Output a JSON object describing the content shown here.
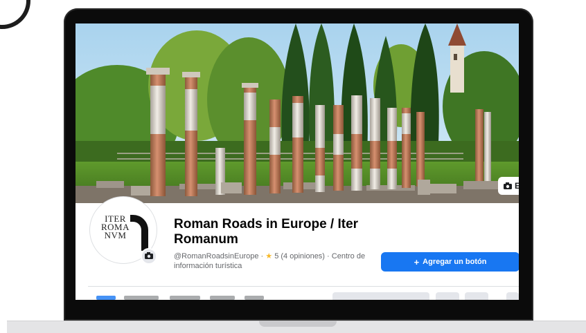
{
  "cover": {
    "edit_cover_label": "E"
  },
  "profile": {
    "logo_lines": [
      "ITER",
      "ROMA",
      "NVM"
    ],
    "name": "Roman Roads in Europe / Iter Romanum",
    "handle": "@RomanRoadsinEurope",
    "separator": "·",
    "rating_star": "★",
    "rating": "5 (4 opiniones)",
    "category": "Centro de información turística"
  },
  "actions": {
    "add_button_label": "Agregar un botón",
    "add_button_icon": "plus-icon"
  },
  "colors": {
    "accent": "#1877f2",
    "star": "#f7b928",
    "laptop_bezel": "#0b0b0b"
  }
}
